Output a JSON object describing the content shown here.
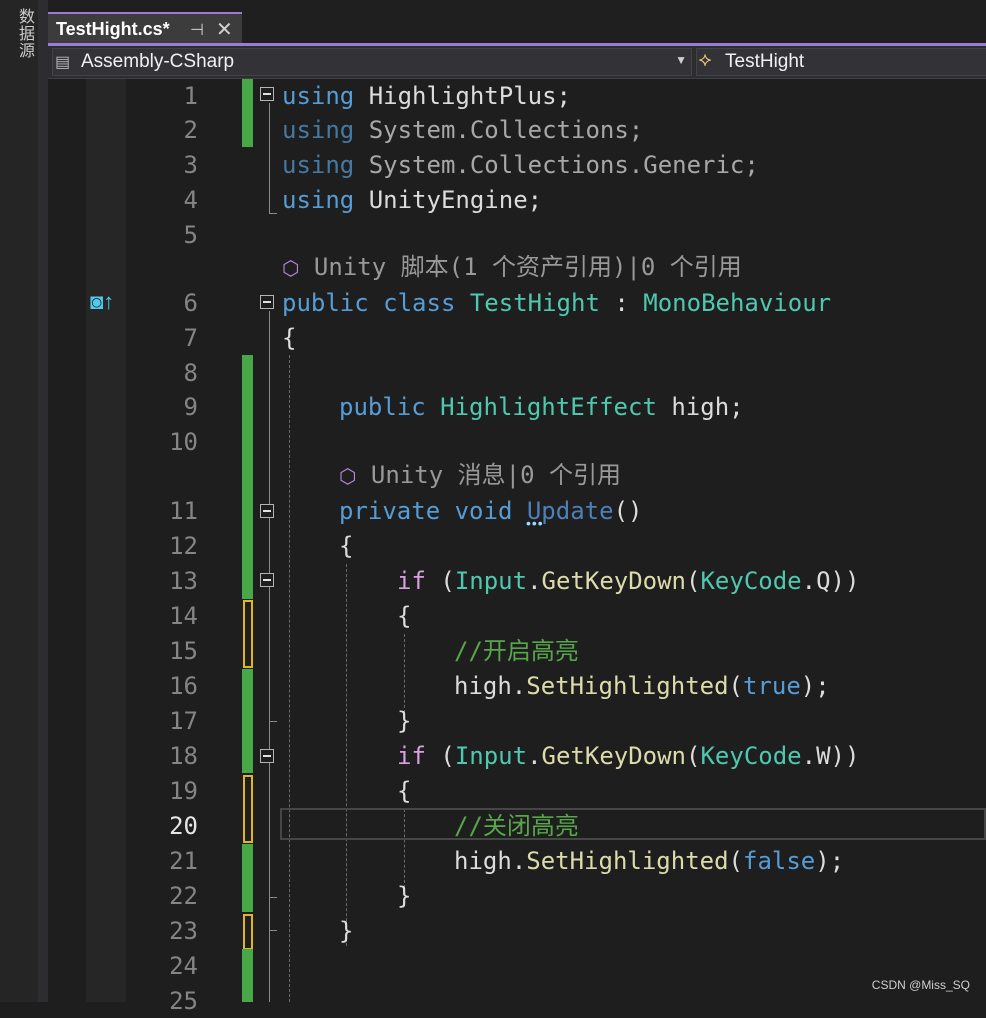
{
  "side_panel": {
    "label": "数据源"
  },
  "tab": {
    "title": "TestHight.cs*",
    "pin_glyph": "⊣",
    "close_glyph": "✕"
  },
  "nav": {
    "project": "Assembly-CSharp",
    "class": "TestHight"
  },
  "lines": [
    {
      "n": "1"
    },
    {
      "n": "2"
    },
    {
      "n": "3"
    },
    {
      "n": "4"
    },
    {
      "n": "5"
    },
    {
      "n": "6"
    },
    {
      "n": "7"
    },
    {
      "n": "8"
    },
    {
      "n": "9"
    },
    {
      "n": "10"
    },
    {
      "n": "11"
    },
    {
      "n": "12"
    },
    {
      "n": "13"
    },
    {
      "n": "14"
    },
    {
      "n": "15"
    },
    {
      "n": "16"
    },
    {
      "n": "17"
    },
    {
      "n": "18"
    },
    {
      "n": "19"
    },
    {
      "n": "20"
    },
    {
      "n": "21"
    },
    {
      "n": "22"
    },
    {
      "n": "23"
    },
    {
      "n": "24"
    },
    {
      "n": "25"
    }
  ],
  "code": {
    "using": "using",
    "highlightplus": "HighlightPlus",
    "system_collections": "System.Collections",
    "system_collections_generic": "System.Collections.Generic",
    "unityengine": "UnityEngine",
    "semi": ";",
    "public": "public",
    "class": "class",
    "class_name": "TestHight",
    "colon": ":",
    "monobehaviour": "MonoBehaviour",
    "open_brace": "{",
    "close_brace": "}",
    "highlight_effect": "HighlightEffect",
    "high_field": "high;",
    "private": "private",
    "void": "void",
    "update": "Update",
    "parens": "()",
    "if": "if",
    "paren_open": "(",
    "input": "Input",
    "dot": ".",
    "getkeydown": "GetKeyDown",
    "keycode": "KeyCode",
    "key_q": "Q",
    "key_w": "W",
    "close_parens": "))",
    "comment_on": "//开启高亮",
    "comment_off": "//关闭高亮",
    "high": "high",
    "sethighlighted": "SetHighlighted",
    "true": "true",
    "false": "false",
    "close_call": ");"
  },
  "lens": {
    "class_refs": "Unity 脚本(1 个资产引用)|0 个引用",
    "update_refs": "Unity 消息|0 个引用"
  },
  "glyphs": {
    "unity_cube": "⬡",
    "breakpoint_arrow": "◙↑",
    "squiggle_dots": "•••"
  },
  "watermark": "CSDN @Miss_SQ",
  "colors": {
    "keyword": "#569cd6",
    "type": "#4ec9b0",
    "method": "#dcdcaa",
    "comment": "#57a64a",
    "control": "#d8a0df",
    "tab_accent": "#9b7bd4",
    "change_green": "#48a848",
    "change_yellow": "#e0b526"
  },
  "editor": {
    "current_line": 20
  }
}
